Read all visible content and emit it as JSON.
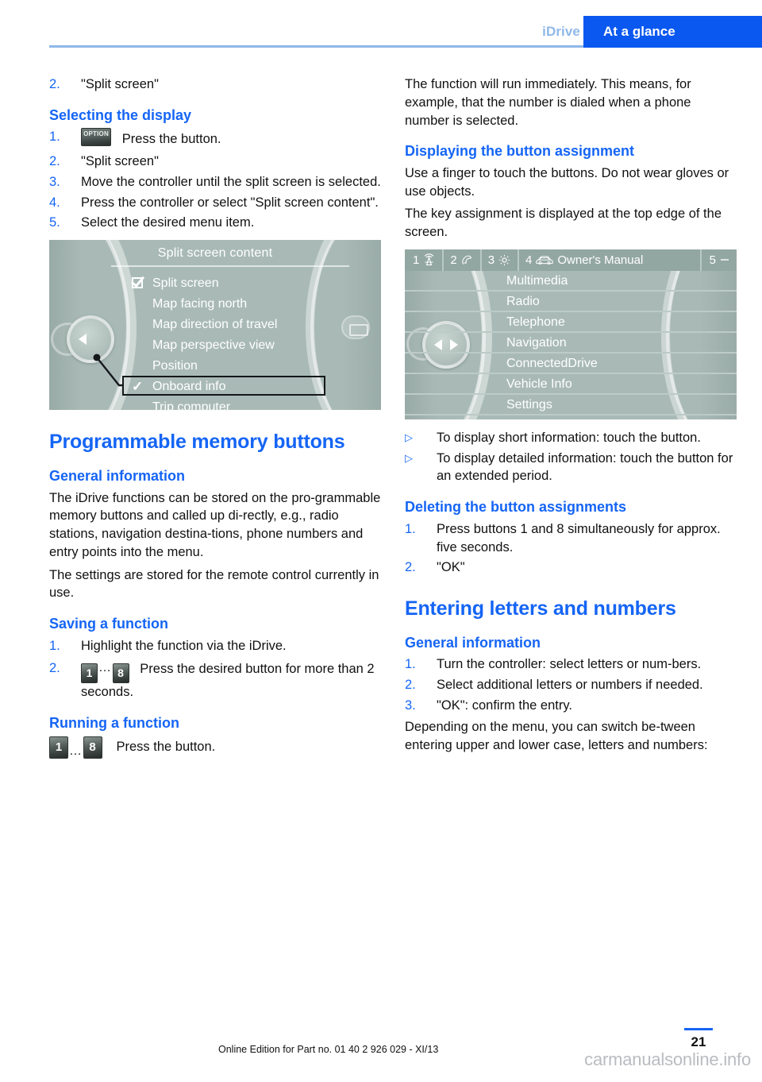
{
  "header": {
    "chapter": "iDrive",
    "tab": "At a glance"
  },
  "left_column": {
    "carryover_item": {
      "marker": "2.",
      "text": "\"Split screen\""
    },
    "selecting_display": {
      "title": "Selecting the display",
      "steps": [
        {
          "marker": "1.",
          "icon": "OPTION",
          "text": "Press the button."
        },
        {
          "marker": "2.",
          "text": "\"Split screen\""
        },
        {
          "marker": "3.",
          "text": "Move the controller until the split screen is selected."
        },
        {
          "marker": "4.",
          "text": "Press the controller or select \"Split screen content\"."
        },
        {
          "marker": "5.",
          "text": "Select the desired menu item."
        }
      ]
    },
    "split_screen_figure": {
      "screen_title": "Split screen content",
      "items": [
        {
          "label": "Split screen",
          "mark": "checkbox"
        },
        {
          "label": "Map facing north",
          "mark": "none"
        },
        {
          "label": "Map direction of travel",
          "mark": "none"
        },
        {
          "label": "Map perspective view",
          "mark": "none"
        },
        {
          "label": "Position",
          "mark": "none"
        },
        {
          "label": "Onboard info",
          "mark": "check",
          "highlighted": true
        },
        {
          "label": "Trip computer",
          "mark": "none"
        }
      ]
    },
    "programmable_memory": {
      "title": "Programmable memory buttons",
      "general_information_heading": "General information",
      "para_1": "The iDrive functions can be stored on the pro‐grammable memory buttons and called up di‐rectly, e.g., radio stations, navigation destina‐tions, phone numbers and entry points into the menu.",
      "para_2": "The settings are stored for the remote control currently in use."
    },
    "saving_function": {
      "title": "Saving a function",
      "step_1": {
        "marker": "1.",
        "text": "Highlight the function via the iDrive."
      },
      "step_2": {
        "marker": "2.",
        "icon_from": "1",
        "icon_dots": "…",
        "icon_to": "8",
        "text": "Press the desired button for more than 2 seconds."
      }
    },
    "running_function": {
      "title": "Running a function",
      "icon_from": "1",
      "icon_dots": "…",
      "icon_to": "8",
      "text": "Press the button."
    }
  },
  "right_column": {
    "intro_para": "The function will run immediately. This means, for example, that the number is dialed when a phone number is selected.",
    "displaying_assignment": {
      "title": "Displaying the button assignment",
      "para_1": "Use a finger to touch the buttons. Do not wear gloves or use objects.",
      "para_2": "The key assignment is displayed at the top edge of the screen."
    },
    "owners_manual_figure": {
      "statusbar": [
        {
          "number": "1",
          "icon": "antenna-icon"
        },
        {
          "number": "2",
          "icon": "phone-handset-icon"
        },
        {
          "number": "3",
          "icon": "gear-icon"
        },
        {
          "number": "4",
          "icon": "car-icon",
          "label": "Owner's Manual"
        },
        {
          "number": "5",
          "icon": "dash-icon"
        }
      ],
      "menu_items": [
        "Multimedia",
        "Radio",
        "Telephone",
        "Navigation",
        "ConnectedDrive",
        "Vehicle Info",
        "Settings"
      ]
    },
    "touch_bullets": [
      {
        "marker": "▷",
        "text": "To display short information: touch the button."
      },
      {
        "marker": "▷",
        "text": "To display detailed information: touch the button for an extended period."
      }
    ],
    "deleting_assignments": {
      "title": "Deleting the button assignments",
      "steps": [
        {
          "marker": "1.",
          "text": "Press buttons 1 and 8 simultaneously for approx. five seconds."
        },
        {
          "marker": "2.",
          "text": "\"OK\""
        }
      ]
    },
    "entering_letters": {
      "title": "Entering letters and numbers",
      "general_information_heading": "General information",
      "steps": [
        {
          "marker": "1.",
          "text": "Turn the controller: select letters or num‐bers."
        },
        {
          "marker": "2.",
          "text": "Select additional letters or numbers if needed."
        },
        {
          "marker": "3.",
          "text": "\"OK\": confirm the entry."
        }
      ],
      "closing_para": "Depending on the menu, you can switch be‐tween entering upper and lower case, letters and numbers:"
    }
  },
  "footer": {
    "note": "Online Edition for Part no. 01 40 2 926 029 - XI/13",
    "page_number": "21",
    "watermark": "carmanualsonline.info"
  },
  "colors": {
    "accent_blue": "#1565f5",
    "tab_blue": "#0a58f0",
    "header_light_blue": "#8fb8e8",
    "screen_bg": "#a9bab6",
    "statusbar_bg": "#93a7a2"
  }
}
